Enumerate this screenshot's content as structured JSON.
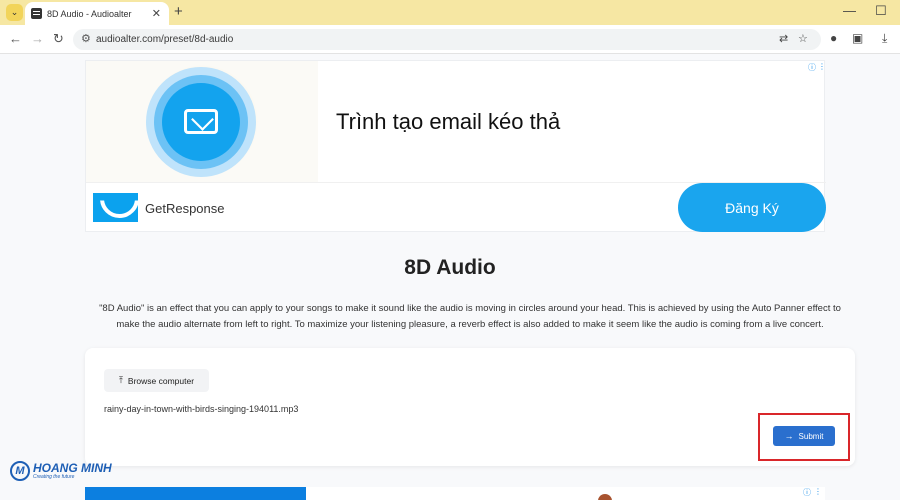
{
  "browser": {
    "tab_title": "8D Audio - Audioalter",
    "url": "audioalter.com/preset/8d-audio",
    "icons": [
      "tab-search-icon",
      "close-icon",
      "plus-icon",
      "minimize-icon",
      "maximize-icon",
      "back-icon",
      "forward-icon",
      "reload-icon",
      "site-info-icon",
      "translate-icon",
      "star-icon",
      "profile-icon",
      "extensions-icon",
      "download-icon"
    ]
  },
  "ad": {
    "headline": "Trình tạo email kéo thả",
    "brand": "GetResponse",
    "cta": "Đăng Ký",
    "brand_color": "#1aa5ee"
  },
  "main": {
    "title": "8D Audio",
    "description": "\"8D Audio\" is an effect that you can apply to your songs to make it sound like the audio is moving in circles around your head. This is achieved by using the Auto Panner effect to make the audio alternate from left to right. To maximize your listening pleasure, a reverb effect is also added to make it seem like the audio is coming from a live concert."
  },
  "upload": {
    "browse_label": "Browse computer",
    "file_name": "rainy-day-in-town-with-birds-singing-194011.mp3",
    "submit_label": "Submit",
    "accent_color": "#2a6fce",
    "highlight_color": "#d9262a"
  },
  "watermark": {
    "brand": "HOANG MINH",
    "tagline": "Creating the future"
  }
}
